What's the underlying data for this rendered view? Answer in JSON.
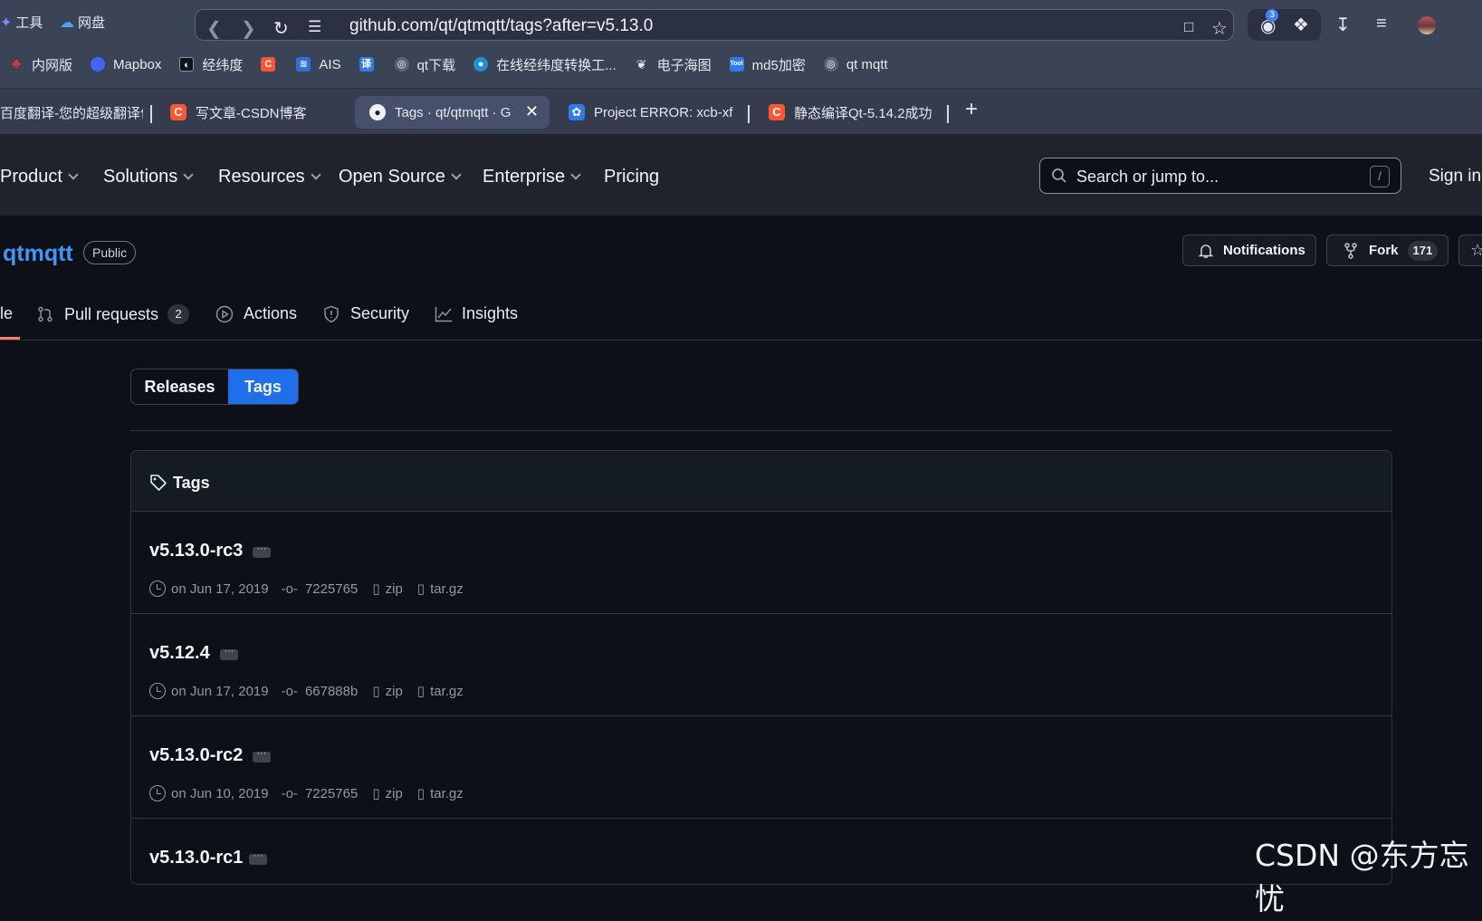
{
  "browser": {
    "left_items": [
      {
        "label": "工具",
        "icon": "puzzle-icon"
      },
      {
        "label": "网盘",
        "icon": "cloud-icon"
      }
    ],
    "address": "github.com/qt/qtmqtt/tags?after=v5.13.0",
    "extension_badge": "3",
    "bookmarks": [
      {
        "label": "内网版",
        "icon": "red-bird-icon",
        "color": "#d9363e"
      },
      {
        "label": "Mapbox",
        "icon": "mapbox-icon",
        "color": "#4264fb"
      },
      {
        "label": "经纬度",
        "icon": "globe-icon",
        "color": "#1f2430"
      },
      {
        "label": "",
        "icon": "csdn-icon",
        "color": "#fc5531"
      },
      {
        "label": "AIS",
        "icon": "ais-icon",
        "color": "#2f6fd6"
      },
      {
        "label": "",
        "icon": "translate-icon",
        "color": "#2f7bea"
      },
      {
        "label": "qt下载",
        "icon": "generic-globe-icon",
        "color": "#5c6374"
      },
      {
        "label": "在线经纬度转换工...",
        "icon": "earth-icon",
        "color": "#1f8fd6"
      },
      {
        "label": "电子海图",
        "icon": "leaf-icon",
        "color": "#5c6374"
      },
      {
        "label": "md5加密",
        "icon": "tool-icon",
        "color": "#2f7bea"
      },
      {
        "label": "qt mqtt",
        "icon": "generic-globe-icon",
        "color": "#5c6374"
      }
    ],
    "tabs": [
      {
        "label": "百度翻译-您的超级翻译伙",
        "icon": "baidu-icon"
      },
      {
        "label": "写文章-CSDN博客",
        "icon": "csdn-icon"
      },
      {
        "label": "Tags · qt/qtmqtt · G",
        "icon": "github-icon",
        "active": true
      },
      {
        "label": "Project ERROR: xcb-xf",
        "icon": "baidu-paw-icon"
      },
      {
        "label": "静态编译Qt-5.14.2成功",
        "icon": "csdn-icon"
      }
    ],
    "new_tab_symbol": "+"
  },
  "github": {
    "nav": [
      "Product",
      "Solutions",
      "Resources",
      "Open Source",
      "Enterprise",
      "Pricing"
    ],
    "search_placeholder": "Search or jump to...",
    "search_shortcut": "/",
    "sign_in": "Sign in"
  },
  "repo": {
    "name": "qtmqtt",
    "visibility": "Public",
    "notifications_label": "Notifications",
    "fork_label": "Fork",
    "fork_count": "171",
    "tabs": [
      {
        "label": "le",
        "active": true
      },
      {
        "label": "Pull requests",
        "count": "2"
      },
      {
        "label": "Actions"
      },
      {
        "label": "Security"
      },
      {
        "label": "Insights"
      }
    ]
  },
  "segmented": {
    "releases": "Releases",
    "tags": "Tags",
    "selected": "Tags"
  },
  "tags_box": {
    "title": "Tags",
    "rows": [
      {
        "name": "v5.13.0-rc3",
        "date": "on Jun 17, 2019",
        "commit": "7225765",
        "zip": "zip",
        "targz": "tar.gz"
      },
      {
        "name": "v5.12.4",
        "date": "on Jun 17, 2019",
        "commit": "667888b",
        "zip": "zip",
        "targz": "tar.gz"
      },
      {
        "name": "v5.13.0-rc2",
        "date": "on Jun 10, 2019",
        "commit": "7225765",
        "zip": "zip",
        "targz": "tar.gz"
      },
      {
        "name": "v5.13.0-rc1",
        "date": "",
        "commit": "",
        "zip": "",
        "targz": ""
      }
    ]
  },
  "watermark": "CSDN @东方忘忧",
  "colors": {
    "accent": "#1f6feb",
    "link": "#4493f8",
    "bg": "#0d1117",
    "header": "#1f232b"
  }
}
